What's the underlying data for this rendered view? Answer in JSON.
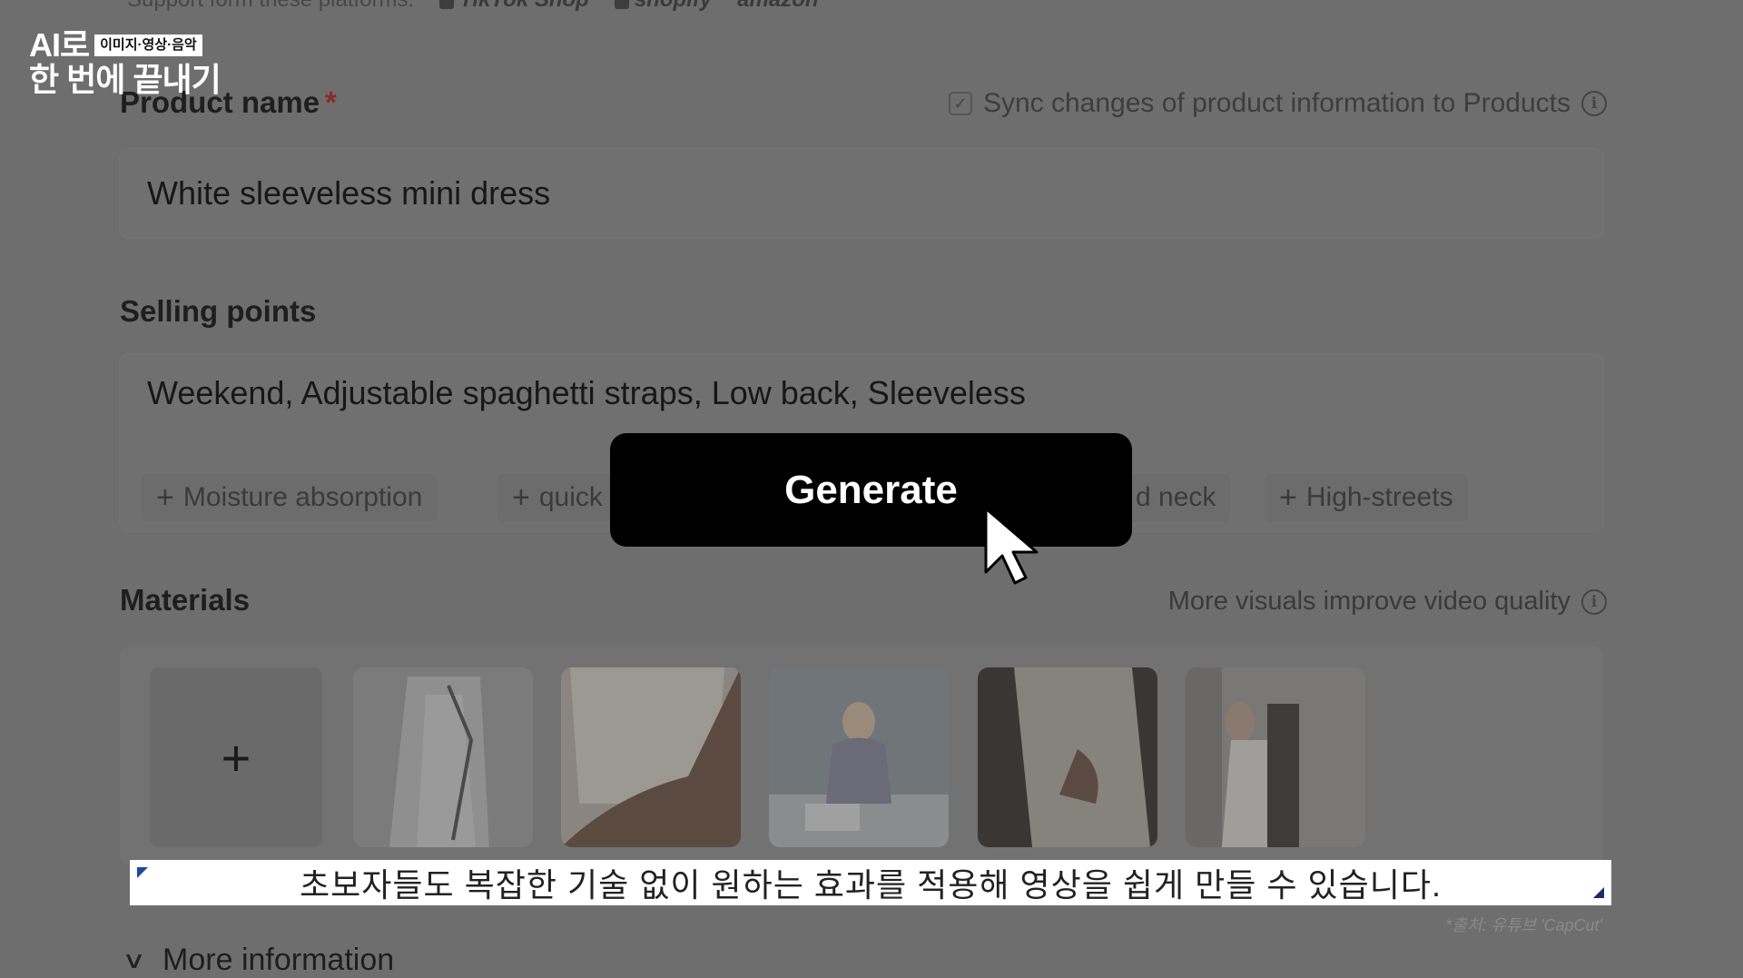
{
  "overlay": {
    "channel_logo": {
      "line1": "AI로",
      "badge": "이미지·영상·음악",
      "line2": "한 번에 끝내기"
    },
    "subtitle": "초보자들도 복잡한 기술 없이 원하는 효과를 적용해 영상을 쉽게 만들 수 있습니다.",
    "source": "*출처: 유튜브 'CapCut'"
  },
  "platforms": {
    "label": "Support form these platforms:",
    "items": [
      "TikTok Shop",
      "shopify",
      "amazon"
    ]
  },
  "product_name": {
    "label": "Product name",
    "required_mark": "*",
    "value": "White sleeveless mini dress",
    "sync_label": "Sync changes of product information to Products",
    "sync_checked": true
  },
  "selling_points": {
    "label": "Selling points",
    "value": "Weekend, Adjustable spaghetti straps, Low back, Sleeveless",
    "chips": [
      "Moisture absorption",
      "quick",
      "d neck",
      "High-streets"
    ]
  },
  "materials": {
    "label": "Materials",
    "hint": "More visuals improve video quality",
    "add_symbol": "+",
    "thumbnails": [
      "dress-on-hanger",
      "dress-hem-hand",
      "woman-at-desk",
      "fabric-closeup",
      "woman-in-dress"
    ]
  },
  "generate_button": {
    "label": "Generate"
  },
  "more_information": {
    "label": "More information"
  },
  "icons": {
    "info": "info-icon",
    "check": "check-icon",
    "chevron": "chevron-down-icon",
    "cursor": "cursor-arrow-icon"
  }
}
